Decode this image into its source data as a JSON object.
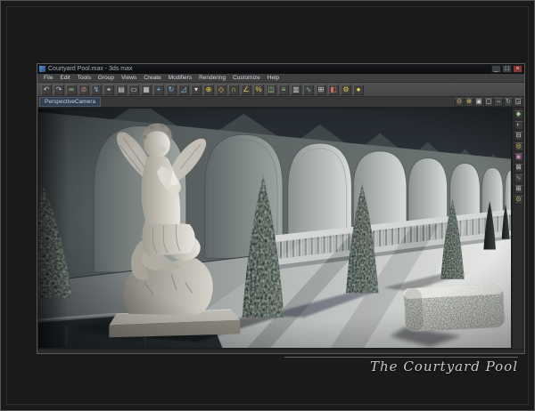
{
  "window": {
    "title": "Courtyard Pool.max - 3ds max",
    "controls": {
      "minimize": "_",
      "restore": "□",
      "close": "×"
    }
  },
  "menubar": {
    "items": [
      {
        "name": "menu-file",
        "label": "File"
      },
      {
        "name": "menu-edit",
        "label": "Edit"
      },
      {
        "name": "menu-tools",
        "label": "Tools"
      },
      {
        "name": "menu-group",
        "label": "Group"
      },
      {
        "name": "menu-views",
        "label": "Views"
      },
      {
        "name": "menu-create",
        "label": "Create"
      },
      {
        "name": "menu-modifiers",
        "label": "Modifiers"
      },
      {
        "name": "menu-rendering",
        "label": "Rendering"
      },
      {
        "name": "menu-customize",
        "label": "Customize"
      },
      {
        "name": "menu-help",
        "label": "Help"
      }
    ]
  },
  "toolbar": {
    "icons": [
      {
        "name": "undo-icon",
        "glyph": "↶",
        "color": "#b9c2c9"
      },
      {
        "name": "redo-icon",
        "glyph": "↷",
        "color": "#b9c2c9"
      },
      {
        "name": "select-link-icon",
        "glyph": "∞",
        "color": "#9fd08a"
      },
      {
        "name": "unlink-icon",
        "glyph": "⊘",
        "color": "#d08a8a"
      },
      {
        "name": "bind-spacewarp-icon",
        "glyph": "↯",
        "color": "#8ab4d0"
      },
      {
        "name": "select-object-icon",
        "glyph": "⌖",
        "color": "#e6e6e6"
      },
      {
        "name": "select-by-name-icon",
        "glyph": "▤",
        "color": "#cfd4d8"
      },
      {
        "name": "selection-region-icon",
        "glyph": "▭",
        "color": "#cfd4d8"
      },
      {
        "name": "window-crossing-icon",
        "glyph": "▦",
        "color": "#cfd4d8"
      },
      {
        "name": "select-move-icon",
        "glyph": "+",
        "color": "#7fc4e8"
      },
      {
        "name": "select-rotate-icon",
        "glyph": "↻",
        "color": "#7fc4e8"
      },
      {
        "name": "select-scale-icon",
        "glyph": "◿",
        "color": "#7fc4e8"
      },
      {
        "name": "ref-coordinate-icon",
        "glyph": "▾",
        "color": "#d8d8d8"
      },
      {
        "name": "use-pivot-icon",
        "glyph": "⊕",
        "color": "#e8c84a"
      },
      {
        "name": "select-manipulate-icon",
        "glyph": "◇",
        "color": "#e8c84a"
      },
      {
        "name": "snap-toggle-icon",
        "glyph": "∩",
        "color": "#e8c84a"
      },
      {
        "name": "angle-snap-icon",
        "glyph": "∠",
        "color": "#e8c84a"
      },
      {
        "name": "percent-snap-icon",
        "glyph": "%",
        "color": "#e8c84a"
      },
      {
        "name": "mirror-icon",
        "glyph": "◫",
        "color": "#9fd08a"
      },
      {
        "name": "align-icon",
        "glyph": "≡",
        "color": "#9fd08a"
      },
      {
        "name": "layer-manager-icon",
        "glyph": "▥",
        "color": "#cfd4d8"
      },
      {
        "name": "curve-editor-icon",
        "glyph": "∿",
        "color": "#8ab4d0"
      },
      {
        "name": "schematic-view-icon",
        "glyph": "⊞",
        "color": "#cfd4d8"
      },
      {
        "name": "material-editor-icon",
        "glyph": "◧",
        "color": "#d06a5a"
      },
      {
        "name": "render-setup-icon",
        "glyph": "⚙",
        "color": "#e8c84a"
      },
      {
        "name": "quick-render-icon",
        "glyph": "●",
        "color": "#e8e05a"
      }
    ]
  },
  "viewport_bar": {
    "tab_label": "PerspectiveCamera",
    "icons": [
      {
        "name": "zoom-icon",
        "glyph": "⊙",
        "color": "#e0c867"
      },
      {
        "name": "zoom-all-icon",
        "glyph": "⊕",
        "color": "#e0c867"
      },
      {
        "name": "zoom-extents-icon",
        "glyph": "▣",
        "color": "#cfd4d8"
      },
      {
        "name": "zoom-extents-all-icon",
        "glyph": "▢",
        "color": "#cfd4d8"
      },
      {
        "name": "pan-icon",
        "glyph": "⇔",
        "color": "#cfd4d8"
      },
      {
        "name": "arc-rotate-icon",
        "glyph": "↻",
        "color": "#8ab4d0"
      },
      {
        "name": "maximize-viewport-icon",
        "glyph": "◲",
        "color": "#cfd4d8"
      }
    ]
  },
  "side_toolbar": {
    "icons": [
      {
        "name": "create-tab-icon",
        "glyph": "◆",
        "color": "#9fd08a"
      },
      {
        "name": "modify-tab-icon",
        "glyph": "◐",
        "color": "#8ab4d0"
      },
      {
        "name": "hierarchy-tab-icon",
        "glyph": "⊟",
        "color": "#cfd4d8"
      },
      {
        "name": "motion-tab-icon",
        "glyph": "◎",
        "color": "#e8c84a"
      },
      {
        "name": "display-tab-icon",
        "glyph": "▣",
        "color": "#d08ac4"
      },
      {
        "name": "utilities-tab-icon",
        "glyph": "⊠",
        "color": "#cfd4d8"
      },
      {
        "name": "track-view-icon",
        "glyph": "∿",
        "color": "#8ab4d0"
      },
      {
        "name": "schematic-icon",
        "glyph": "⊞",
        "color": "#cfd4d8"
      },
      {
        "name": "lock-selection-icon",
        "glyph": "⊙",
        "color": "#e8c84a"
      }
    ]
  },
  "caption": {
    "text": "The Courtyard Pool"
  },
  "colors": {
    "frame_bg": "#1a1a1a",
    "titlebar_bg": "#0c0d10",
    "toolbar_bg": "#474747",
    "viewport_sky": "#2a3136",
    "viewport_floor": "#d9dbd9",
    "statue_stone": "#d9d7d0",
    "foliage_dark": "#1c2220",
    "caption_text": "#c8c8c8"
  }
}
